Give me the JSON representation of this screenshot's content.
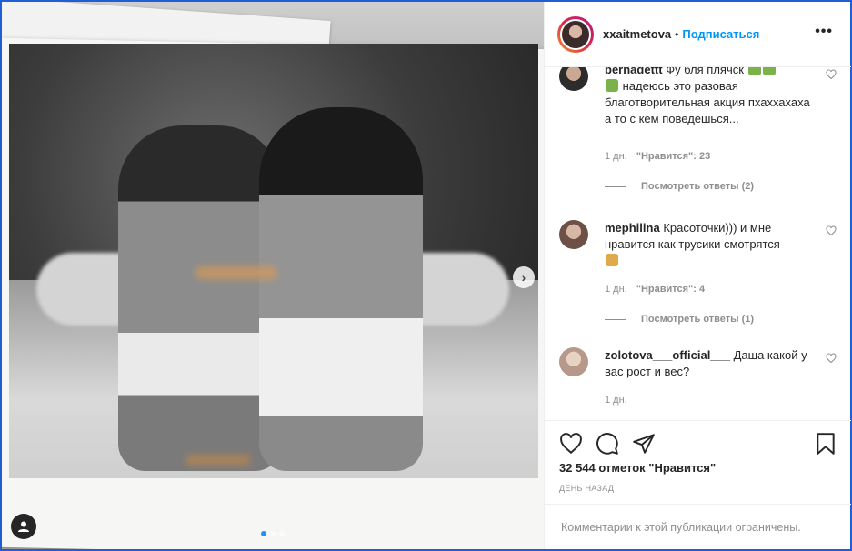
{
  "post": {
    "username": "xxaitmetova",
    "separator": "•",
    "follow_label": "Подписаться",
    "more_label": "•••"
  },
  "media": {
    "next_label": "›",
    "carousel_dots": 3,
    "active_dot": 0
  },
  "comments": [
    {
      "user": "bernadettt",
      "text": "Фу бля плячск",
      "text2": "надеюсь это разовая благотворительная акция пхаххахаха а то с кем поведёшься...",
      "time": "1 дн.",
      "likes_label": "\"Нравится\": 23",
      "replies_label": "Посмотреть ответы (2)"
    },
    {
      "user": "mephilina",
      "text": "Красоточки))) и мне нравится как трусики смотрятся",
      "time": "1 дн.",
      "likes_label": "\"Нравится\": 4",
      "replies_label": "Посмотреть ответы (1)"
    },
    {
      "user": "zolotova___official___",
      "text": "Даша какой у вас рост и вес?",
      "time": "1 дн."
    }
  ],
  "footer": {
    "likes_text": "32 544 отметок \"Нравится\"",
    "date_text": "ДЕНЬ НАЗАД",
    "comments_disabled": "Комментарии к этой публикации ограничены."
  },
  "icons": [
    "heart-icon",
    "comment-icon",
    "share-icon",
    "bookmark-icon",
    "user-tag-icon",
    "more-icon",
    "chevron-right-icon"
  ],
  "colors": {
    "accent": "#0095f6",
    "text": "#262626",
    "muted": "#8e8e8e",
    "frame": "#1e5fd6"
  }
}
